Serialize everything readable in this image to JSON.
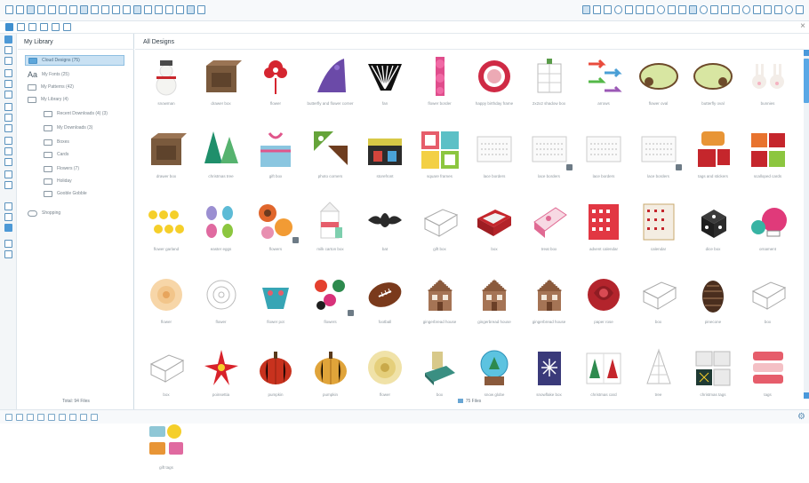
{
  "toolbar": {
    "left_icons": [
      "new-document-icon",
      "open-icon",
      "save-icon",
      "print-icon",
      "cut-icon",
      "copy-icon",
      "paste-icon",
      "undo-icon",
      "redo-icon",
      "select-icon",
      "zoom-in-icon",
      "zoom-out-icon",
      "pan-icon",
      "grid-icon",
      "pointer-icon",
      "cursor-icon",
      "move-icon",
      "fit-icon",
      "zoom-icon"
    ],
    "right_icons": [
      "design-icon",
      "page-setup-icon",
      "fill-icon",
      "offset-icon",
      "trace-icon",
      "align-icon",
      "replicate-icon",
      "text-icon",
      "transform-icon",
      "store-icon",
      "library-icon",
      "send-icon",
      "settings-icon",
      "help-icon",
      "layers-icon",
      "color-icon",
      "line-icon",
      "image-icon",
      "panel-icon",
      "extra-icon",
      "more-icon"
    ]
  },
  "subbar": {
    "icons": [
      "list-view-icon",
      "grid-view-icon",
      "folder-icon",
      "cloud-icon",
      "search-icon",
      "filter-icon"
    ],
    "close_label": "×"
  },
  "library": {
    "title": "My Library",
    "items": [
      {
        "label": "Cloud Designs (75)",
        "icon": "library-icon",
        "selected": true,
        "indent": 0
      },
      {
        "label": "My Fonts (25)",
        "icon": "fonts-icon",
        "selected": false,
        "indent": 0
      },
      {
        "label": "My Patterns (42)",
        "icon": "folder-icon",
        "selected": false,
        "indent": 0
      },
      {
        "label": "My Library (4)",
        "icon": "folder-icon",
        "selected": false,
        "indent": 0
      },
      {
        "label": "Recent Downloads (4) (3)",
        "icon": "folder-icon",
        "selected": false,
        "indent": 1
      },
      {
        "label": "My Downloads (3)",
        "icon": "folder-icon",
        "selected": false,
        "indent": 1
      },
      {
        "label": "Boxes",
        "icon": "folder-icon",
        "selected": false,
        "indent": 1
      },
      {
        "label": "Cards",
        "icon": "folder-icon",
        "selected": false,
        "indent": 1
      },
      {
        "label": "Flowers (7)",
        "icon": "folder-icon",
        "selected": false,
        "indent": 1
      },
      {
        "label": "Holiday",
        "icon": "folder-icon",
        "selected": false,
        "indent": 1
      },
      {
        "label": "Gooble Gobble",
        "icon": "folder-icon",
        "selected": false,
        "indent": 1
      },
      {
        "label": "Shopping",
        "icon": "cloud-icon",
        "selected": false,
        "indent": 0
      }
    ],
    "total": "Total: 94 Files"
  },
  "content": {
    "title": "All Designs",
    "count": "75 Files",
    "items": [
      {
        "caption": "snowman",
        "art": "snowman"
      },
      {
        "caption": "drawer box",
        "art": "box"
      },
      {
        "caption": "flower",
        "art": "flower"
      },
      {
        "caption": "butterfly and flower corner",
        "art": "corner"
      },
      {
        "caption": "fan",
        "art": "fan"
      },
      {
        "caption": "flower border",
        "art": "border"
      },
      {
        "caption": "happy birthday frame",
        "art": "frame"
      },
      {
        "caption": "2x2x2 shadow box",
        "art": "whitebox"
      },
      {
        "caption": "arrows",
        "art": "arrows"
      },
      {
        "caption": "flower oval",
        "art": "oval"
      },
      {
        "caption": "butterfly oval",
        "art": "oval2"
      },
      {
        "caption": "bunnies",
        "art": "bunnies"
      },
      {
        "caption": "drawer box",
        "art": "box2"
      },
      {
        "caption": "christmas tree",
        "art": "trees"
      },
      {
        "caption": "gift box",
        "art": "giftbox"
      },
      {
        "caption": "photo corners",
        "art": "corners"
      },
      {
        "caption": "storefront",
        "art": "store"
      },
      {
        "caption": "square frames",
        "art": "frames"
      },
      {
        "caption": "lace borders",
        "art": "lace"
      },
      {
        "caption": "lace borders",
        "art": "lace"
      },
      {
        "caption": "lace borders",
        "art": "lace"
      },
      {
        "caption": "lace borders",
        "art": "lace"
      },
      {
        "caption": "tags and stickers",
        "art": "tags"
      },
      {
        "caption": "scalloped cards",
        "art": "cards"
      },
      {
        "caption": "flower garland",
        "art": "garland"
      },
      {
        "caption": "easter eggs",
        "art": "eggs"
      },
      {
        "caption": "flowers",
        "art": "flowers2"
      },
      {
        "caption": "milk carton box",
        "art": "milk"
      },
      {
        "caption": "bat",
        "art": "bat"
      },
      {
        "caption": "gift box",
        "art": "outline"
      },
      {
        "caption": "box",
        "art": "redbox"
      },
      {
        "caption": "treat box",
        "art": "treatbox"
      },
      {
        "caption": "advent calendar",
        "art": "advent"
      },
      {
        "caption": "calendar",
        "art": "calendar"
      },
      {
        "caption": "dice box",
        "art": "dice"
      },
      {
        "caption": "ornament",
        "art": "ornament"
      },
      {
        "caption": "flower",
        "art": "peachflower"
      },
      {
        "caption": "flower",
        "art": "lineflower"
      },
      {
        "caption": "flower pot",
        "art": "pot"
      },
      {
        "caption": "flowers",
        "art": "flowers3"
      },
      {
        "caption": "football",
        "art": "football"
      },
      {
        "caption": "gingerbread house",
        "art": "house"
      },
      {
        "caption": "gingerbread house",
        "art": "house"
      },
      {
        "caption": "gingerbread house",
        "art": "house"
      },
      {
        "caption": "paper rose",
        "art": "rose"
      },
      {
        "caption": "box",
        "art": "outline2"
      },
      {
        "caption": "pinecone",
        "art": "pinecone"
      },
      {
        "caption": "box",
        "art": "outline3"
      },
      {
        "caption": "box",
        "art": "outline3"
      },
      {
        "caption": "poinsettia",
        "art": "poinsettia"
      },
      {
        "caption": "pumpkin",
        "art": "pumpkin"
      },
      {
        "caption": "pumpkin",
        "art": "pumpkin2"
      },
      {
        "caption": "flower",
        "art": "paperflower"
      },
      {
        "caption": "box",
        "art": "tealbox"
      },
      {
        "caption": "snow globe",
        "art": "globe"
      },
      {
        "caption": "snowflake box",
        "art": "snowbox"
      },
      {
        "caption": "christmas card",
        "art": "xmascard"
      },
      {
        "caption": "tree",
        "art": "linetree"
      },
      {
        "caption": "christmas tags",
        "art": "chalk"
      },
      {
        "caption": "tags",
        "art": "tags2"
      },
      {
        "caption": "gift tags",
        "art": "tags3"
      }
    ]
  },
  "bottombar": {
    "icons": [
      "grid-icon",
      "snap-icon",
      "fill-icon",
      "line-icon",
      "group-icon",
      "ungroup-icon",
      "weld-icon",
      "rotate-icon",
      "settings-icon"
    ],
    "right_icon": "settings-icon"
  },
  "colors": {
    "accent": "#3f8fcf",
    "selection": "#c9e1f3",
    "border": "#dfe6ec"
  }
}
